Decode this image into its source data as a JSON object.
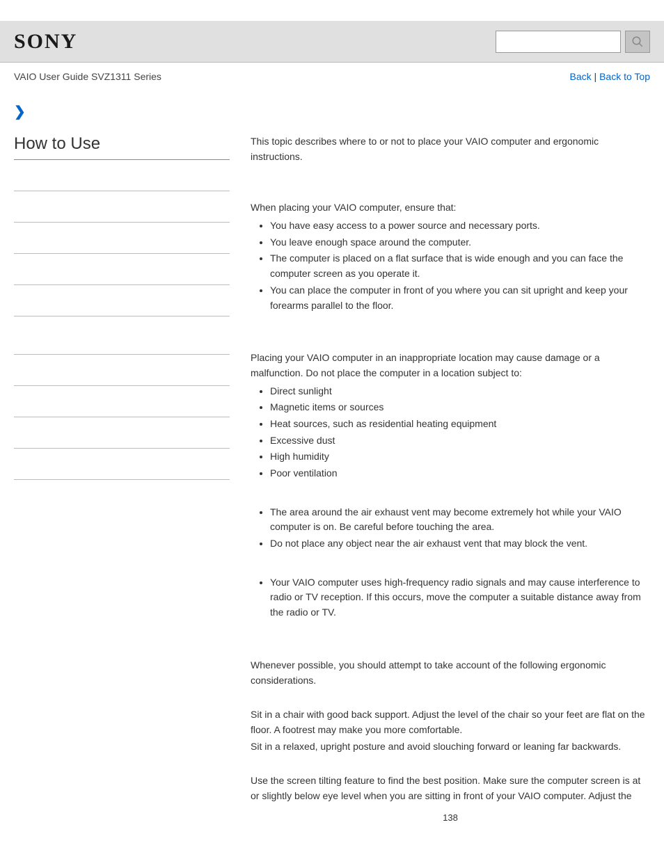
{
  "header": {
    "logo_text": "SONY",
    "search_placeholder": ""
  },
  "subheader": {
    "guide_title": "VAIO User Guide SVZ1311 Series",
    "back_label": "Back",
    "back_to_top_label": "Back to Top",
    "separator": " | "
  },
  "sidebar": {
    "heading": "How to Use"
  },
  "main": {
    "intro": "This topic describes where to or not to place your VAIO computer and ergonomic instructions.",
    "placing_intro": "When placing your VAIO computer, ensure that:",
    "placing_items": [
      "You have easy access to a power source and necessary ports.",
      "You leave enough space around the computer.",
      "The computer is placed on a flat surface that is wide enough and you can face the computer screen as you operate it.",
      "You can place the computer in front of you where you can sit upright and keep your forearms parallel to the floor."
    ],
    "avoid_intro": "Placing your VAIO computer in an inappropriate location may cause damage or a malfunction. Do not place the computer in a location subject to:",
    "avoid_items": [
      "Direct sunlight",
      "Magnetic items or sources",
      "Heat sources, such as residential heating equipment",
      "Excessive dust",
      "High humidity",
      "Poor ventilation"
    ],
    "vent_items": [
      "The area around the air exhaust vent may become extremely hot while your VAIO computer is on. Be careful before touching the area.",
      "Do not place any object near the air exhaust vent that may block the vent."
    ],
    "radio_items": [
      "Your VAIO computer uses high-frequency radio signals and may cause interference to radio or TV reception. If this occurs, move the computer a suitable distance away from the radio or TV."
    ],
    "ergo_intro": "Whenever possible, you should attempt to take account of the following ergonomic considerations.",
    "sit_para1": "Sit in a chair with good back support. Adjust the level of the chair so your feet are flat on the floor. A footrest may make you more comfortable.",
    "sit_para2": "Sit in a relaxed, upright posture and avoid slouching forward or leaning far backwards.",
    "screen_para": "Use the screen tilting feature to find the best position. Make sure the computer screen is at or slightly below eye level when you are sitting in front of your VAIO computer. Adjust the"
  },
  "page_number": "138"
}
